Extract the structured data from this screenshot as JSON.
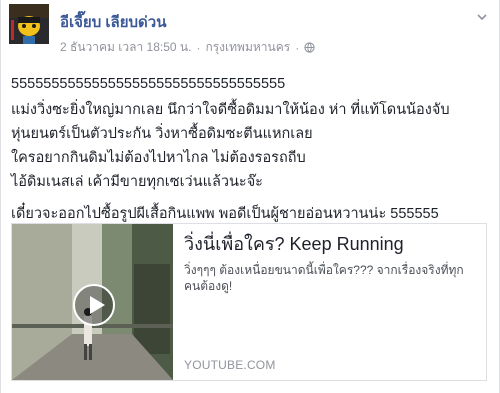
{
  "post": {
    "author": "อีเจี๊ยบ เลียบด่วน",
    "date": "2 ธันวาคม เวลา 18:50 น.",
    "separator": "·",
    "location": "กรุงเทพมหานคร",
    "privacy_icon": "globe-icon",
    "lines": [
      "5555555555555555555555555555555555",
      "แม่งวิ่งซะยิ่งใหญ่มากเลย นึกว่าใจดีซื้อดิมมาให้น้อง ห่า ที่แท้โดนน้องจับ",
      "หุ่นยนตร์เป็นตัวประกัน วิ่งหาซื้อดิมซะตีนแหกเลย",
      "ใครอยากกินดิมไม่ต้องไปหาไกล ไม่ต้องรอรถถีบ",
      "ไอ้ดิมเนสเล่ เค้ามีขายทุกเซเว่นแล้วนะจ๊ะ",
      "เดี๋ยวจะออกไปซื้อรูปผีเสื้อกินแพพ พอดีเป็นผู้ชายอ่อนหวานน่ะ 555555"
    ]
  },
  "link_card": {
    "title": "วิ่งนี่เพื่อใคร? Keep Running",
    "description": "วิ่งๆๆๆ ต้องเหนื่อยขนาดนี้เพื่อใคร??? จากเรื่องจริงที่ทุกคนต้องดู!",
    "domain": "YOUTUBE.COM"
  },
  "colors": {
    "author_link": "#3b5998",
    "meta_text": "#90949c",
    "body_text": "#1d2129"
  }
}
